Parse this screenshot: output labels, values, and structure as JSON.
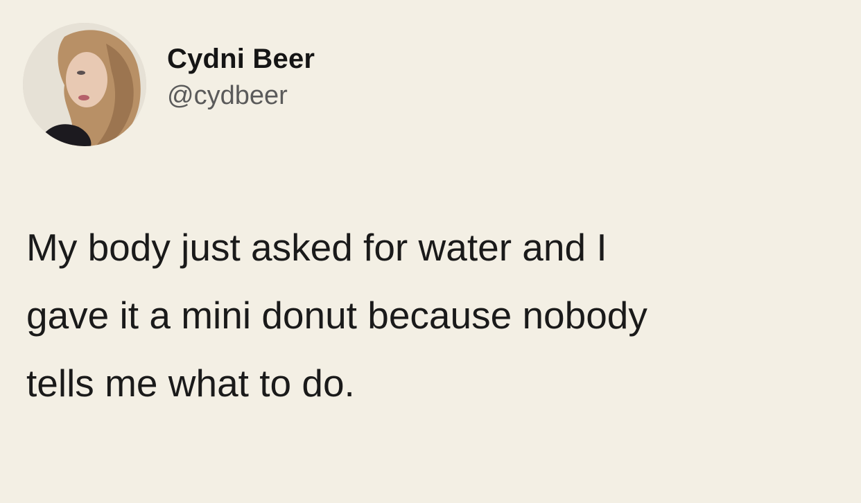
{
  "tweet": {
    "author": {
      "display_name": "Cydni Beer",
      "handle": "@cydbeer",
      "avatar_icon": "profile-photo"
    },
    "text_lines": [
      "My body just asked for water and I",
      "gave it a mini donut because nobody",
      "tells me what to do."
    ]
  },
  "colors": {
    "background": "#f3efe4",
    "text": "#1a1a1a",
    "handle": "#5a5a5a"
  }
}
